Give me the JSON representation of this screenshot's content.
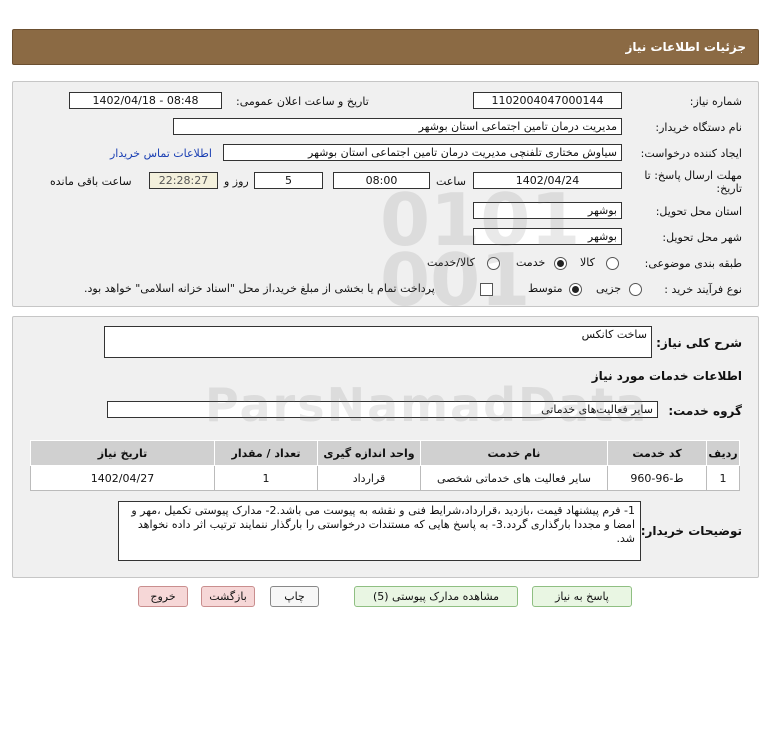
{
  "header": {
    "title": "جزئیات اطلاعات نیاز"
  },
  "form": {
    "need_number_label": "شماره نیاز:",
    "need_number": "1102004047000144",
    "announce_label": "تاریخ و ساعت اعلان عمومی:",
    "announce_value": "1402/04/18 - 08:48",
    "buyer_org_label": "نام دستگاه خریدار:",
    "buyer_org": "مدیریت درمان تامین اجتماعی استان بوشهر",
    "creator_label": "ایجاد کننده درخواست:",
    "creator": "سیاوش مختاری تلفنچی مدیریت درمان تامین اجتماعی استان بوشهر",
    "contact_link": "اطلاعات تماس خریدار",
    "deadline_label_1": "مهلت ارسال پاسخ: تا",
    "deadline_label_2": "تاریخ:",
    "deadline_date": "1402/04/24",
    "time_label": "ساعت",
    "deadline_time": "08:00",
    "days_value": "5",
    "days_label": "روز و",
    "remaining_time": "22:28:27",
    "remaining_label": "ساعت باقی مانده",
    "province_label": "استان محل تحویل:",
    "province": "بوشهر",
    "city_label": "شهر محل تحویل:",
    "city": "بوشهر",
    "category_label": "طبقه بندی موضوعی:",
    "category_options": [
      "کالا",
      "خدمت",
      "کالا/خدمت"
    ],
    "category_selected": "خدمت",
    "process_label": "نوع فرآیند خرید :",
    "process_options": [
      "جزیی",
      "متوسط"
    ],
    "process_selected": "متوسط",
    "treasury_text": "پرداخت تمام یا بخشی از مبلغ خرید،از محل \"اسناد خزانه اسلامی\" خواهد بود."
  },
  "need": {
    "summary_label": "شرح کلی نیاز:",
    "summary": "ساخت کانکس",
    "services_heading": "اطلاعات خدمات مورد نیاز",
    "service_group_label": "گروه خدمت:",
    "service_group": "سایر فعالیت‌های خدماتی",
    "table_headers": [
      "ردیف",
      "کد خدمت",
      "نام خدمت",
      "واحد اندازه گیری",
      "تعداد / مقدار",
      "تاریخ نیاز"
    ],
    "table_rows": [
      [
        "1",
        "ط-96-960",
        "سایر فعالیت های خدماتی شخصی",
        "قرارداد",
        "1",
        "1402/04/27"
      ]
    ],
    "buyer_notes_label": "توضیحات خریدار:",
    "buyer_notes": "1- فرم پیشنهاد قیمت ،بازدید ،قرارداد،شرایط فنی و نقشه به پیوست می باشد.2- مدارک پیوستی تکمیل ،مهر و امضا و مجددا بارگذاری گردد.3- به پاسخ هایی که مستندات درخواستی را بارگذار ننمایند ترتیب اثر داده نخواهد شد."
  },
  "buttons": {
    "respond": "پاسخ به نیاز",
    "attachments": "مشاهده مدارک پیوستی (5)",
    "print": "چاپ",
    "back": "بازگشت",
    "exit": "خروج"
  },
  "colors": {
    "header_bg": "#8b6a44",
    "panel_bg": "#f0f0f0",
    "link": "#1a3fb3",
    "exit_button": "#f6d7d7"
  }
}
